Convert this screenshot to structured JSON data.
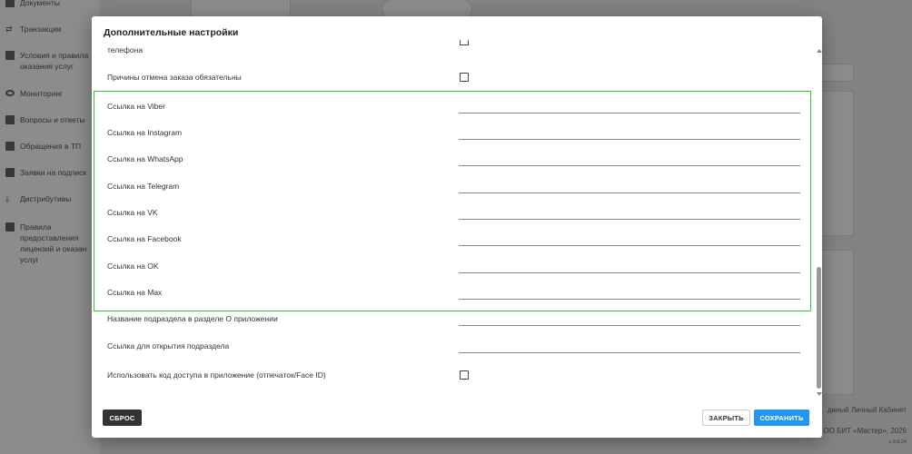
{
  "sidebar": {
    "items": [
      {
        "label": "Документы",
        "icon": "document-icon"
      },
      {
        "label": "Транзакции",
        "icon": "swap-icon"
      },
      {
        "label": "Условия и правила оказания услуг",
        "icon": "clipboard-icon"
      },
      {
        "label": "Мониторинг",
        "icon": "eye-icon"
      },
      {
        "label": "Вопросы и ответы",
        "icon": "question-icon"
      },
      {
        "label": "Обращения в ТП",
        "icon": "chat-icon"
      },
      {
        "label": "Заявки на подписк",
        "icon": "list-icon"
      },
      {
        "label": "Дистрибутивы",
        "icon": "download-icon"
      },
      {
        "label": "Правила предоставления лицензий и оказан услуг",
        "icon": "folder-icon"
      }
    ]
  },
  "footer": {
    "line1": "диный Личный Кабинет",
    "line2": "ОО БИТ «Мастер», 2026",
    "version": "v 3.6.24"
  },
  "dialog": {
    "title": "Дополнительные настройки",
    "partial_label": "телефона",
    "rows": {
      "cancel_reasons": "Причины отмена заказа обязательны",
      "viber": "Ссылка на Viber",
      "instagram": "Ссылка на Instagram",
      "whatsapp": "Ссылка на WhatsApp",
      "telegram": "Ссылка на Telegram",
      "vk": "Ссылка на VK",
      "facebook": "Ссылка на Facebook",
      "ok": "Ссылка на OK",
      "max": "Ссылка на Max",
      "subsection_name": "Название подраздела в разделе О приложении",
      "subsection_link": "Ссылка для открытия подраздела",
      "access_code": "Использовать код доступа в приложение (отпечаток/Face ID)"
    },
    "values": {
      "viber": "",
      "instagram": "",
      "whatsapp": "",
      "telegram": "",
      "vk": "",
      "facebook": "",
      "ok": "",
      "max": "",
      "subsection_name": "",
      "subsection_link": ""
    },
    "buttons": {
      "reset": "СБРОС",
      "close": "ЗАКРЫТЬ",
      "save": "СОХРАНИТЬ"
    }
  },
  "colors": {
    "accent": "#2196f3",
    "highlight_border": "#2ecc2e",
    "reset_button": "#333333"
  }
}
